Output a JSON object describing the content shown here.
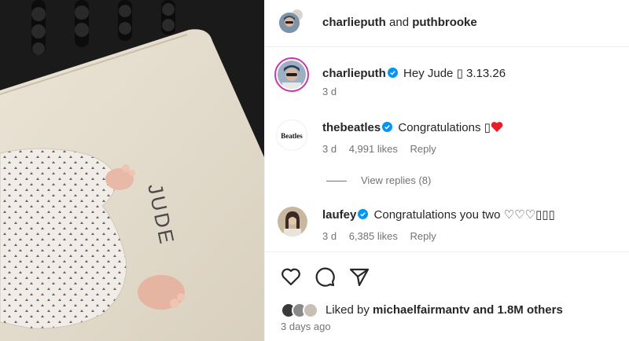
{
  "photo": {
    "mattress_text": "JUDE",
    "alt": "photo"
  },
  "header": {
    "user1": "charlieputh",
    "joiner": "and",
    "user2": "puthbrooke"
  },
  "caption": {
    "username": "charlieputh",
    "text": "Hey Jude ▯ 3.13.26",
    "time": "3 d"
  },
  "comments": [
    {
      "username": "thebeatles",
      "avatar_text": "Beatles",
      "text": "Congratulations ▯",
      "time": "3 d",
      "likes": "4,991 likes",
      "reply": "Reply"
    },
    {
      "username": "laufey",
      "text": "Congratulations you two ♡♡♡▯▯▯",
      "time": "3 d",
      "likes": "6,385 likes",
      "reply": "Reply"
    }
  ],
  "view_replies": "View replies (8)",
  "liked": {
    "prefix": "Liked by",
    "user": "michaelfairmantv",
    "suffix": "and 1.8M others"
  },
  "date": "3 days ago",
  "colors": {
    "verified": "#0095f6",
    "heart": "#ed4956",
    "muted": "#737373",
    "text": "#262626"
  },
  "icons": [
    "verified-icon",
    "heart-icon",
    "comment-icon",
    "share-icon",
    "heart-emoji-icon"
  ]
}
